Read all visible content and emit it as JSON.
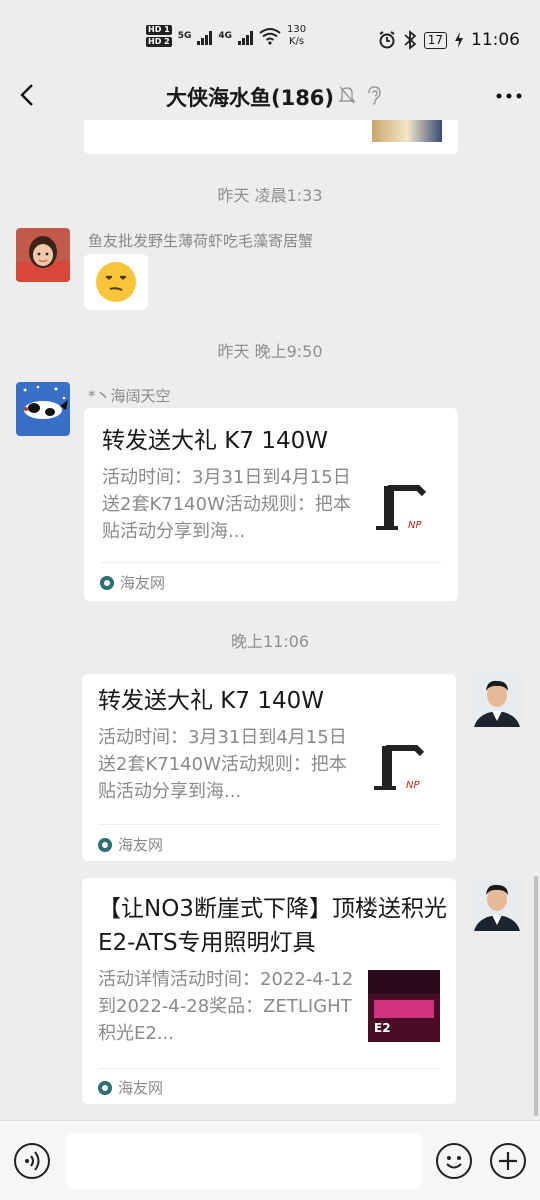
{
  "status_bar": {
    "hd1": "HD 1",
    "hd2": "HD 2",
    "net1": "5G",
    "net2": "4G",
    "speed_value": "130",
    "speed_unit": "K/s",
    "battery": "17",
    "time": "11:06"
  },
  "header": {
    "title": "大侠海水鱼(186)",
    "back_icon": "chevron-left-icon",
    "mute_icon": "bell-off-icon",
    "earpiece_icon": "ear-icon",
    "more_icon": "more-dots-icon"
  },
  "messages": {
    "ts1": "昨天 凌晨1:33",
    "sender1": "鱼友批发野生薄荷虾吃毛藻寄居蟹",
    "emoji1": "smirk-emoji",
    "ts2": "昨天 晚上9:50",
    "sender2": "*丶海阔天空",
    "card1": {
      "title": "转发送大礼 K7 140W",
      "desc": "活动时间：3月31日到4月15日送2套K7140W活动规则：把本贴活动分享到海...",
      "source": "海友网"
    },
    "ts3": "晚上11:06",
    "card2": {
      "title": "转发送大礼 K7 140W",
      "desc": "活动时间：3月31日到4月15日送2套K7140W活动规则：把本贴活动分享到海...",
      "source": "海友网"
    },
    "card3": {
      "title": "【让NO3断崖式下降】顶楼送积光E2-ATS专用照明灯具",
      "desc": "活动详情活动时间：2022-4-12到2022-4-28奖品：ZETLIGHT积光E2...",
      "source": "海友网",
      "thumb_text": "E2"
    }
  },
  "input_bar": {
    "voice_icon": "voice-icon",
    "emoji_icon": "emoji-icon",
    "plus_icon": "plus-icon"
  }
}
